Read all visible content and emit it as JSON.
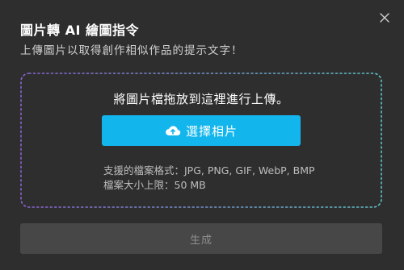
{
  "dialog": {
    "title": "圖片轉 AI 繪圖指令",
    "subtitle": "上傳圖片以取得創作相似作品的提示文字！",
    "close_icon": "close-icon"
  },
  "dropzone": {
    "instruction": "將圖片檔拖放到這裡進行上傳。",
    "choose_button_label": "選擇相片",
    "choose_button_icon": "cloud-upload-icon",
    "formats_text": "支援的檔案格式：JPG, PNG, GIF, WebP, BMP",
    "size_limit_text": "檔案大小上限：50 MB",
    "border_gradient": [
      "#8a63d2",
      "#5ec4c8"
    ]
  },
  "actions": {
    "generate_label": "生成",
    "generate_disabled": true
  },
  "colors": {
    "background": "#2e2e2e",
    "accent": "#13b6ec",
    "disabled_button": "#474747"
  }
}
